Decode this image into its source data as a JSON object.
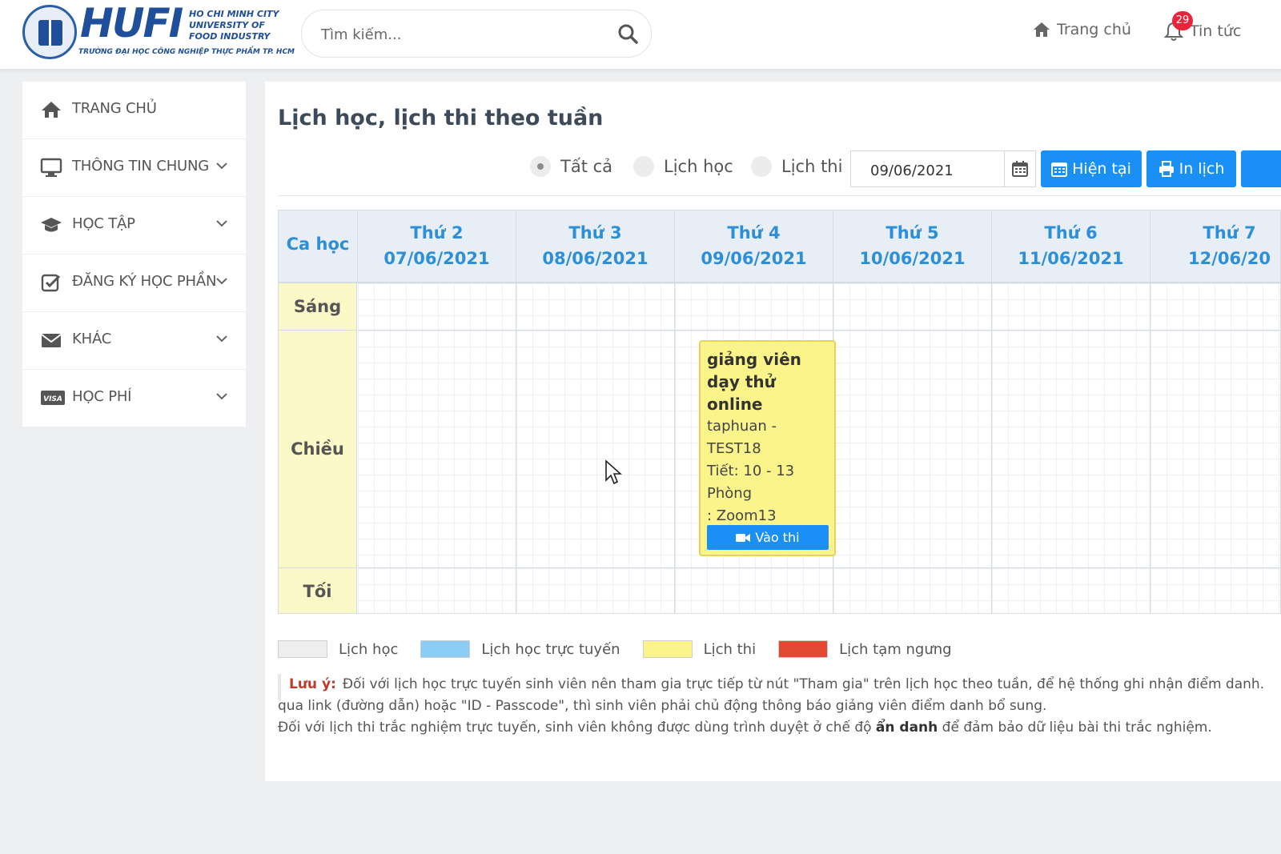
{
  "header": {
    "logo": {
      "name": "HUFI",
      "sub_line1": "HO CHI MINH CITY",
      "sub_line2": "UNIVERSITY OF",
      "sub_line3": "FOOD INDUSTRY",
      "tagline": "TRƯỜNG ĐẠI HỌC CÔNG NGHIỆP THỰC PHẨM TP. HCM"
    },
    "search": {
      "placeholder": "Tìm kiếm...",
      "value": ""
    },
    "nav": {
      "home": "Trang chủ",
      "news": "Tin tức",
      "notification_count": "29"
    }
  },
  "sidebar": {
    "items": [
      {
        "label": "TRANG CHỦ",
        "icon": "home-icon",
        "has_submenu": false
      },
      {
        "label": "THÔNG TIN CHUNG",
        "icon": "monitor-icon",
        "has_submenu": true
      },
      {
        "label": "HỌC TẬP",
        "icon": "graduation-cap-icon",
        "has_submenu": true
      },
      {
        "label": "ĐĂNG KÝ HỌC PHẦN",
        "icon": "checkbox-icon",
        "has_submenu": true
      },
      {
        "label": "KHÁC",
        "icon": "envelope-icon",
        "has_submenu": true
      },
      {
        "label": "HỌC PHÍ",
        "icon": "visa-card-icon",
        "has_submenu": true
      }
    ]
  },
  "main": {
    "title": "Lịch học, lịch thi theo tuần",
    "filters": [
      {
        "label": "Tất cả",
        "selected": true
      },
      {
        "label": "Lịch học",
        "selected": false
      },
      {
        "label": "Lịch thi",
        "selected": false
      }
    ],
    "date_value": "09/06/2021",
    "buttons": {
      "current": "Hiện tại",
      "print": "In lịch"
    },
    "calendar": {
      "shift_header": "Ca học",
      "days": [
        {
          "name": "Thứ 2",
          "date": "07/06/2021"
        },
        {
          "name": "Thứ 3",
          "date": "08/06/2021"
        },
        {
          "name": "Thứ 4",
          "date": "09/06/2021"
        },
        {
          "name": "Thứ 5",
          "date": "10/06/2021"
        },
        {
          "name": "Thứ 6",
          "date": "11/06/2021"
        },
        {
          "name": "Thứ 7",
          "date": "12/06/20"
        }
      ],
      "shifts": [
        "Sáng",
        "Chiều",
        "Tối"
      ],
      "event": {
        "title": "giảng viên dạy thử online",
        "line1": "taphuan -",
        "line2": "TEST18",
        "line3": "Tiết: 10 - 13",
        "line4": "Phòng",
        "line5": ": Zoom13",
        "button": "Vào thi"
      }
    },
    "legend": [
      {
        "label": "Lịch học",
        "color": "#eeeeee"
      },
      {
        "label": "Lịch học trực tuyến",
        "color": "#8ccdf5"
      },
      {
        "label": "Lịch thi",
        "color": "#fbf48a"
      },
      {
        "label": "Lịch tạm ngưng",
        "color": "#e04a32"
      }
    ],
    "note": {
      "title": "Lưu ý:",
      "line1": "Đối với lịch học trực tuyến sinh viên nên tham gia trực tiếp từ nút \"Tham gia\" trên lịch học theo tuần, để hệ thống ghi nhận điểm danh.",
      "line2": "qua link (đường dẫn) hoặc \"ID - Passcode\", thì sinh viên phải chủ động thông báo giảng viên điểm danh bổ sung.",
      "line3_pre": "Đối với lịch thi trắc nghiệm trực tuyến, sinh viên không được dùng trình duyệt ở chế độ ",
      "line3_bold": "ẩn danh",
      "line3_post": " để đảm bảo dữ liệu bài thi trắc nghiệm."
    }
  }
}
